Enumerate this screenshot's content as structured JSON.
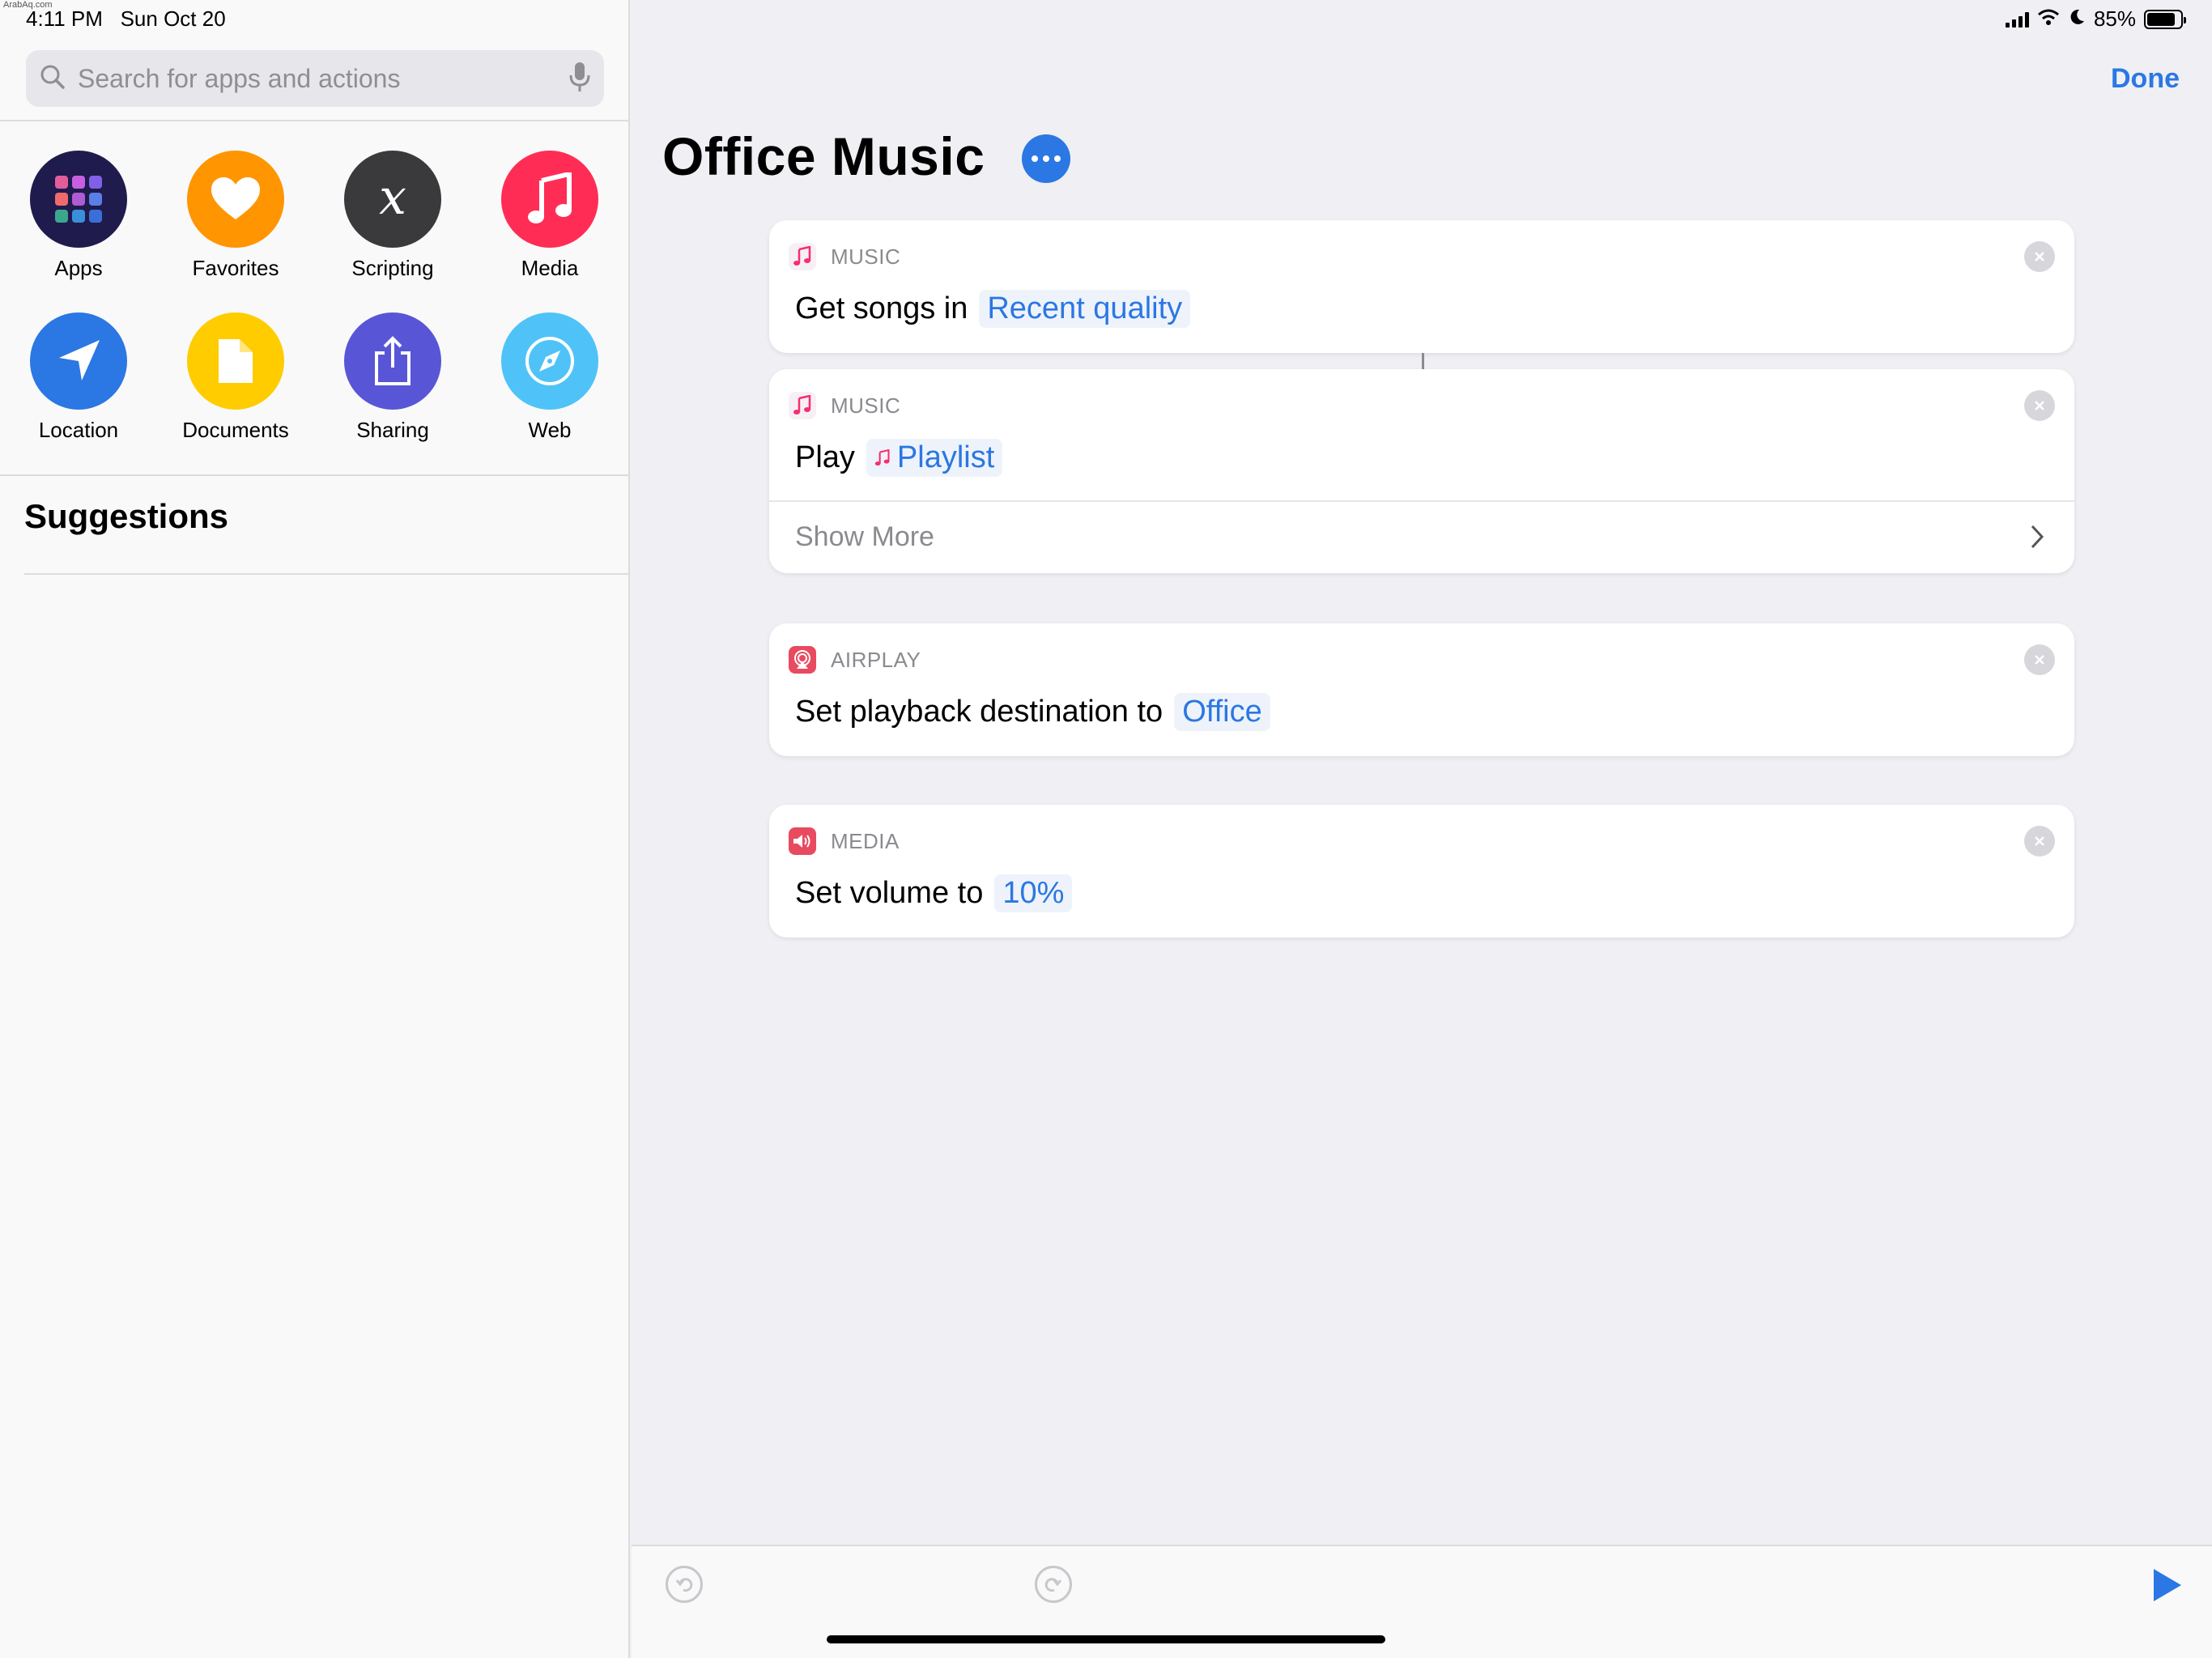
{
  "status": {
    "watermark": "ArabAq.com",
    "time": "4:11 PM",
    "date": "Sun Oct 20",
    "battery": "85%"
  },
  "sidebar": {
    "search_placeholder": "Search for apps and actions",
    "categories": [
      {
        "label": "Apps",
        "icon": "apps-grid-icon",
        "color": "#1f1b4d"
      },
      {
        "label": "Favorites",
        "icon": "heart-icon",
        "color": "#ff9500"
      },
      {
        "label": "Scripting",
        "icon": "variable-x-icon",
        "color": "#3a3a3c"
      },
      {
        "label": "Media",
        "icon": "music-note-icon",
        "color": "#ff2d55"
      },
      {
        "label": "Location",
        "icon": "location-arrow-icon",
        "color": "#2b77e3"
      },
      {
        "label": "Documents",
        "icon": "document-icon",
        "color": "#ffcc00"
      },
      {
        "label": "Sharing",
        "icon": "share-icon",
        "color": "#5856d6"
      },
      {
        "label": "Web",
        "icon": "compass-icon",
        "color": "#4fc3f7"
      }
    ],
    "suggestions_title": "Suggestions"
  },
  "header": {
    "done": "Done",
    "title": "Office Music"
  },
  "actions": [
    {
      "category": "MUSIC",
      "text": "Get songs in",
      "token": "Recent quality"
    },
    {
      "category": "MUSIC",
      "text": "Play",
      "token": "Playlist",
      "show_more": "Show More"
    },
    {
      "category": "AIRPLAY",
      "text": "Set playback destination to",
      "token": "Office"
    },
    {
      "category": "MEDIA",
      "text": "Set volume to",
      "token": "10%"
    }
  ],
  "colors": {
    "accent": "#2b77e3",
    "music": "#fa2d6e",
    "airplay": "#e84a5f"
  }
}
